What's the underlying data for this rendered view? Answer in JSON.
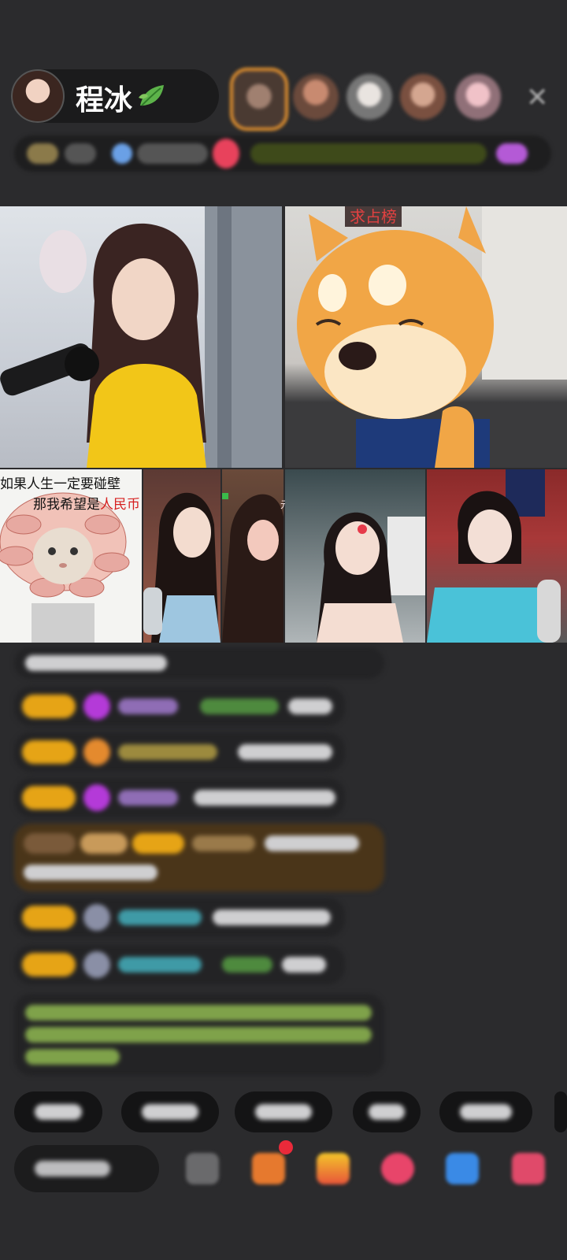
{
  "header": {
    "host_name": "程冰",
    "host_badge_icon": "leaf-icon",
    "close_icon": "close-icon"
  },
  "video": {
    "rank_label": "求占榜",
    "meme_text_line1": "如果人生一定要碰壁",
    "meme_text_line2_prefix": "那我希望是",
    "meme_text_line2_highlight": "人民币",
    "seat_tag": "元榜"
  },
  "colors": {
    "background": "#2b2b2d",
    "level_badge": "#e6a416",
    "close_highlight": "#e6932f",
    "rank_label_text": "#e24141",
    "meme_highlight": "#d61f1f"
  }
}
